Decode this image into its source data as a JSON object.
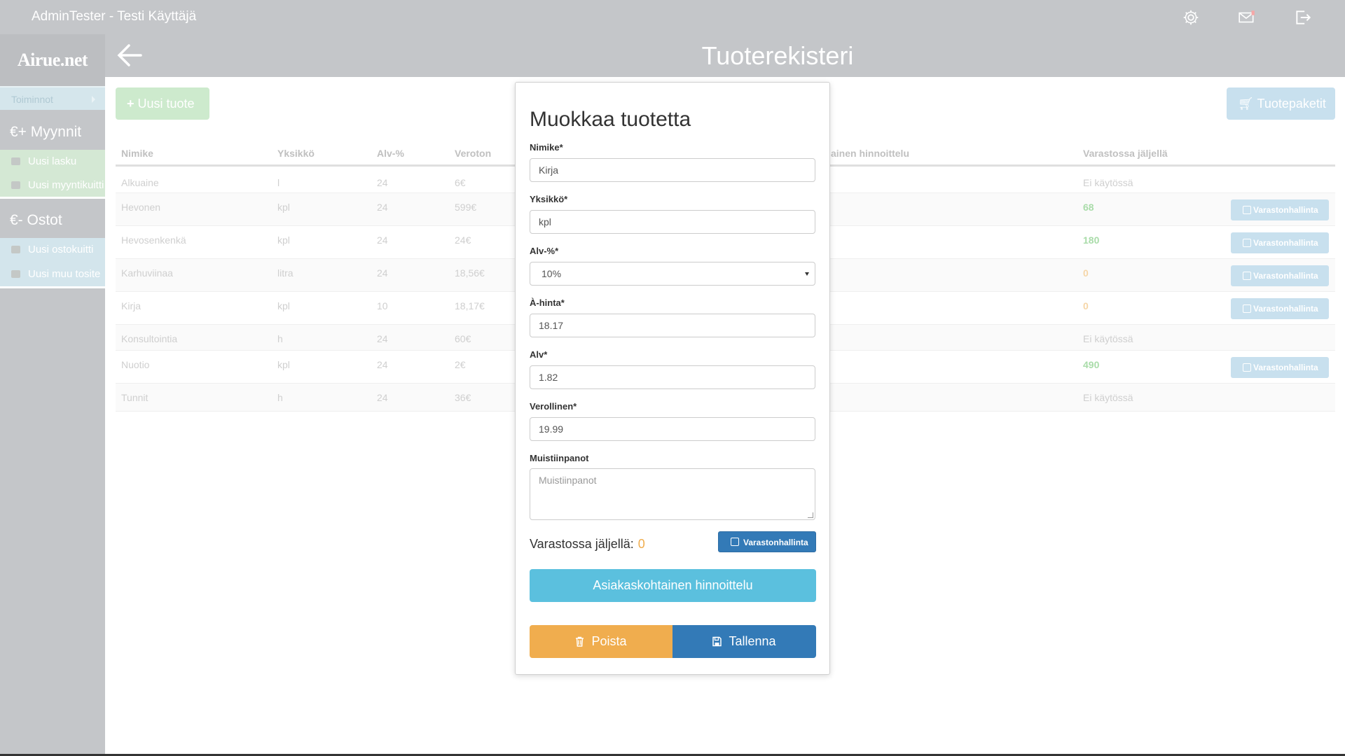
{
  "topbar": {
    "user_label": "AdminTester - Testi Käyttäjä",
    "icons": [
      "gear-icon",
      "mail-icon",
      "logout-icon"
    ]
  },
  "sidebar": {
    "logo": "Airue.net",
    "toiminnot_label": "Toiminnot",
    "sales": {
      "title": "€+  Myynnit",
      "items": [
        {
          "label": "Uusi lasku",
          "icon": "piggy-bank-icon"
        },
        {
          "label": "Uusi myyntikuitti",
          "icon": "camera-icon"
        }
      ]
    },
    "purchases": {
      "title": "€-  Ostot",
      "items": [
        {
          "label": "Uusi ostokuitti",
          "icon": "camera-icon"
        },
        {
          "label": "Uusi muu tosite",
          "icon": "camera-icon"
        }
      ]
    }
  },
  "page": {
    "title": "Tuoterekisteri",
    "new_product_label": "Uusi tuote",
    "packages_label": "Tuotepaketit"
  },
  "table": {
    "columns": [
      "Nimike",
      "Yksikkö",
      "Alv-%",
      "Veroton",
      "ainen hinnoittelu",
      "Varastossa jäljellä"
    ],
    "action_label": "Varastonhallinta",
    "rows": [
      {
        "name": "Alkuaine",
        "unit": "l",
        "vat": "24",
        "price": "6€",
        "stock": "Ei käytössä",
        "stock_type": "none"
      },
      {
        "name": "Hevonen",
        "unit": "kpl",
        "vat": "24",
        "price": "599€",
        "stock": "68",
        "stock_type": "green"
      },
      {
        "name": "Hevosenkenkä",
        "unit": "kpl",
        "vat": "24",
        "price": "24€",
        "stock": "180",
        "stock_type": "green"
      },
      {
        "name": "Karhuviinaa",
        "unit": "litra",
        "vat": "24",
        "price": "18,56€",
        "stock": "0",
        "stock_type": "orange"
      },
      {
        "name": "Kirja",
        "unit": "kpl",
        "vat": "10",
        "price": "18,17€",
        "stock": "0",
        "stock_type": "orange"
      },
      {
        "name": "Konsultointia",
        "unit": "h",
        "vat": "24",
        "price": "60€",
        "stock": "Ei käytössä",
        "stock_type": "none"
      },
      {
        "name": "Nuotio",
        "unit": "kpl",
        "vat": "24",
        "price": "2€",
        "stock": "490",
        "stock_type": "green"
      },
      {
        "name": "Tunnit",
        "unit": "h",
        "vat": "24",
        "price": "36€",
        "stock": "Ei käytössä",
        "stock_type": "none"
      }
    ]
  },
  "modal": {
    "title": "Muokkaa tuotetta",
    "fields": {
      "nimike": {
        "label": "Nimike*",
        "value": "Kirja"
      },
      "yksikko": {
        "label": "Yksikkö*",
        "value": "kpl"
      },
      "alv_pct": {
        "label": "Alv-%*",
        "value": "10%"
      },
      "ahinta": {
        "label": "À-hinta*",
        "value": "18.17"
      },
      "alv": {
        "label": "Alv*",
        "value": "1.82"
      },
      "verollinen": {
        "label": "Verollinen*",
        "value": "19.99"
      },
      "muistiinpanot": {
        "label": "Muistiinpanot",
        "placeholder": "Muistiinpanot"
      }
    },
    "stock_label": "Varastossa jäljellä:",
    "stock_value": "0",
    "inventory_button": "Varastonhallinta",
    "pricing_button": "Asiakaskohtainen hinnoittelu",
    "delete_button": "Poista",
    "save_button": "Tallenna"
  },
  "colors": {
    "primary": "#337ab7",
    "info": "#5bc0de",
    "warning": "#f0ad4e",
    "chrome": "#c4c6c9"
  }
}
